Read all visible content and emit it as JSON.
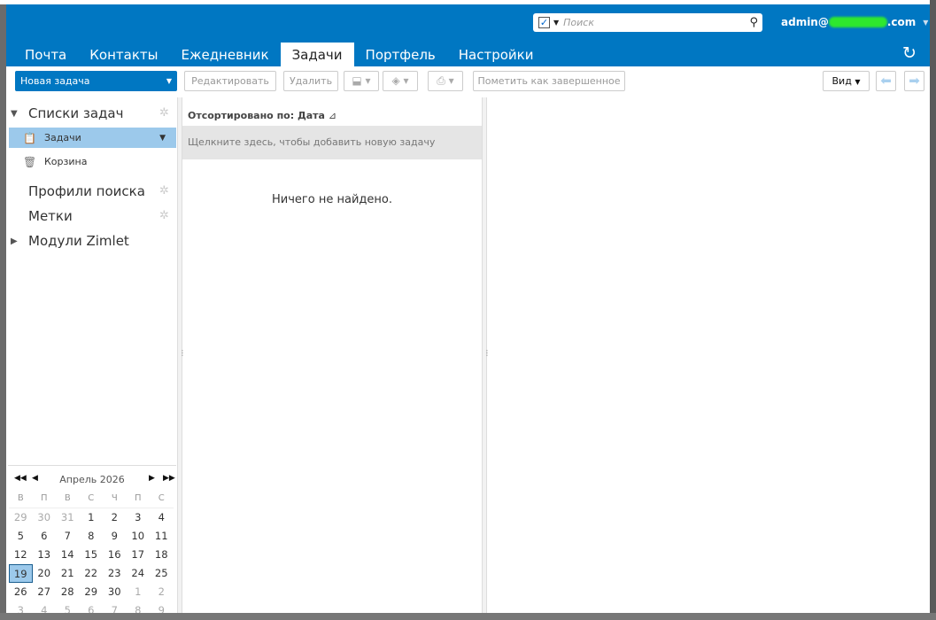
{
  "header": {
    "search_placeholder": "Поиск",
    "user_prefix": "admin@",
    "user_suffix": ".com"
  },
  "tabs": [
    "Почта",
    "Контакты",
    "Ежедневник",
    "Задачи",
    "Портфель",
    "Настройки"
  ],
  "toolbar": {
    "new_task": "Новая задача",
    "edit": "Редактировать",
    "delete": "Удалить",
    "mark_complete": "Пометить как завершенное",
    "view": "Вид"
  },
  "sidebar": {
    "task_lists": "Списки задач",
    "items": [
      "Задачи",
      "Корзина"
    ],
    "search_profiles": "Профили поиска",
    "tags": "Метки",
    "zimlets": "Модули Zimlet"
  },
  "list": {
    "sort": "Отсортировано по: Дата",
    "add_hint": "Щелкните здесь, чтобы добавить новую задачу",
    "empty": "Ничего не найдено."
  },
  "calendar": {
    "title": "Апрель 2026",
    "dow": [
      "В",
      "П",
      "В",
      "С",
      "Ч",
      "П",
      "С"
    ],
    "days": [
      [
        "29",
        "30",
        "31",
        "1",
        "2",
        "3",
        "4"
      ],
      [
        "5",
        "6",
        "7",
        "8",
        "9",
        "10",
        "11"
      ],
      [
        "12",
        "13",
        "14",
        "15",
        "16",
        "17",
        "18"
      ],
      [
        "19",
        "20",
        "21",
        "22",
        "23",
        "24",
        "25"
      ],
      [
        "26",
        "27",
        "28",
        "29",
        "30",
        "1",
        "2"
      ],
      [
        "3",
        "4",
        "5",
        "6",
        "7",
        "8",
        "9"
      ]
    ],
    "today": "19"
  }
}
